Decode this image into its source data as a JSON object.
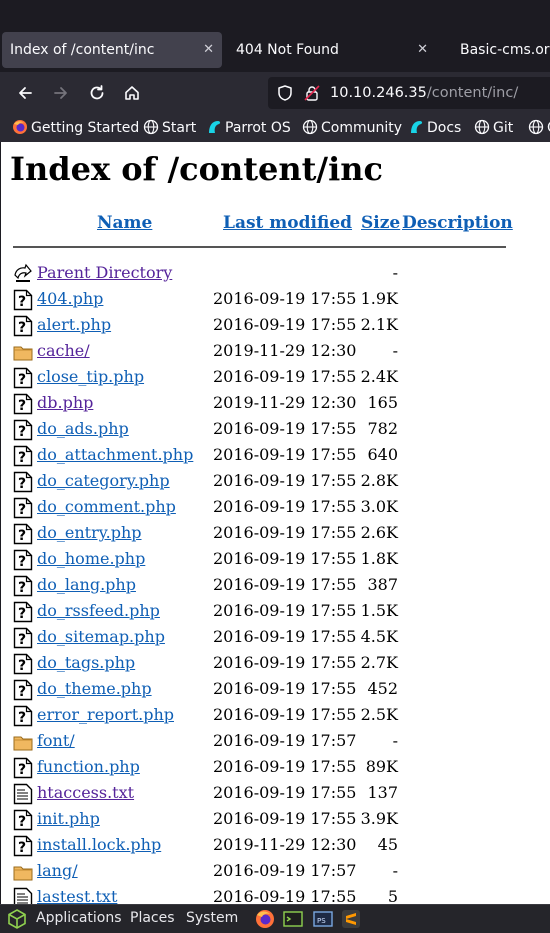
{
  "tabs": [
    {
      "label": "Index of /content/inc",
      "active": true
    },
    {
      "label": "404 Not Found",
      "active": false
    },
    {
      "label": "Basic-cms.org",
      "active": false
    }
  ],
  "tab_close_glyph": "✕",
  "nav": {
    "url_host": "10.10.246.35",
    "url_path": "/content/inc/"
  },
  "bookmarks": [
    {
      "label": "Getting Started",
      "icon": "firefox-icon"
    },
    {
      "label": "Start",
      "icon": "globe-icon"
    },
    {
      "label": "Parrot OS",
      "icon": "parrot-icon"
    },
    {
      "label": "Community",
      "icon": "globe-icon"
    },
    {
      "label": "Docs",
      "icon": "parrot-icon"
    },
    {
      "label": "Git",
      "icon": "globe-icon"
    },
    {
      "label": "C",
      "icon": "globe-icon"
    }
  ],
  "page": {
    "title": "Index of /content/inc",
    "headers": {
      "name": "Name",
      "modified": "Last modified",
      "size": "Size",
      "description": "Description"
    },
    "parent": {
      "name": "Parent Directory",
      "size": "-"
    },
    "files": [
      {
        "name": "404.php",
        "date": "2016-09-19 17:55",
        "size": "1.9K",
        "type": "unknown",
        "visited": false
      },
      {
        "name": "alert.php",
        "date": "2016-09-19 17:55",
        "size": "2.1K",
        "type": "unknown",
        "visited": false
      },
      {
        "name": "cache/",
        "date": "2019-11-29 12:30",
        "size": "-",
        "type": "folder",
        "visited": true
      },
      {
        "name": "close_tip.php",
        "date": "2016-09-19 17:55",
        "size": "2.4K",
        "type": "unknown",
        "visited": false
      },
      {
        "name": "db.php",
        "date": "2019-11-29 12:30",
        "size": "165",
        "type": "unknown",
        "visited": true
      },
      {
        "name": "do_ads.php",
        "date": "2016-09-19 17:55",
        "size": "782",
        "type": "unknown",
        "visited": false
      },
      {
        "name": "do_attachment.php",
        "date": "2016-09-19 17:55",
        "size": "640",
        "type": "unknown",
        "visited": false
      },
      {
        "name": "do_category.php",
        "date": "2016-09-19 17:55",
        "size": "2.8K",
        "type": "unknown",
        "visited": false
      },
      {
        "name": "do_comment.php",
        "date": "2016-09-19 17:55",
        "size": "3.0K",
        "type": "unknown",
        "visited": false
      },
      {
        "name": "do_entry.php",
        "date": "2016-09-19 17:55",
        "size": "2.6K",
        "type": "unknown",
        "visited": false
      },
      {
        "name": "do_home.php",
        "date": "2016-09-19 17:55",
        "size": "1.8K",
        "type": "unknown",
        "visited": false
      },
      {
        "name": "do_lang.php",
        "date": "2016-09-19 17:55",
        "size": "387",
        "type": "unknown",
        "visited": false
      },
      {
        "name": "do_rssfeed.php",
        "date": "2016-09-19 17:55",
        "size": "1.5K",
        "type": "unknown",
        "visited": false
      },
      {
        "name": "do_sitemap.php",
        "date": "2016-09-19 17:55",
        "size": "4.5K",
        "type": "unknown",
        "visited": false
      },
      {
        "name": "do_tags.php",
        "date": "2016-09-19 17:55",
        "size": "2.7K",
        "type": "unknown",
        "visited": false
      },
      {
        "name": "do_theme.php",
        "date": "2016-09-19 17:55",
        "size": "452",
        "type": "unknown",
        "visited": false
      },
      {
        "name": "error_report.php",
        "date": "2016-09-19 17:55",
        "size": "2.5K",
        "type": "unknown",
        "visited": false
      },
      {
        "name": "font/",
        "date": "2016-09-19 17:57",
        "size": "-",
        "type": "folder",
        "visited": false
      },
      {
        "name": "function.php",
        "date": "2016-09-19 17:55",
        "size": "89K",
        "type": "unknown",
        "visited": false
      },
      {
        "name": "htaccess.txt",
        "date": "2016-09-19 17:55",
        "size": "137",
        "type": "text",
        "visited": true
      },
      {
        "name": "init.php",
        "date": "2016-09-19 17:55",
        "size": "3.9K",
        "type": "unknown",
        "visited": false
      },
      {
        "name": "install.lock.php",
        "date": "2019-11-29 12:30",
        "size": "45",
        "type": "unknown",
        "visited": false
      },
      {
        "name": "lang/",
        "date": "2016-09-19 17:57",
        "size": "-",
        "type": "folder",
        "visited": false
      },
      {
        "name": "lastest.txt",
        "date": "2016-09-19 17:55",
        "size": "5",
        "type": "text",
        "visited": false
      }
    ]
  },
  "taskbar": {
    "applications": "Applications",
    "places": "Places",
    "system": "System"
  },
  "colors": {
    "link": "#0f5fb5",
    "visited": "#55249a",
    "chrome_dark": "#1c1b22",
    "chrome": "#2b2a33"
  }
}
